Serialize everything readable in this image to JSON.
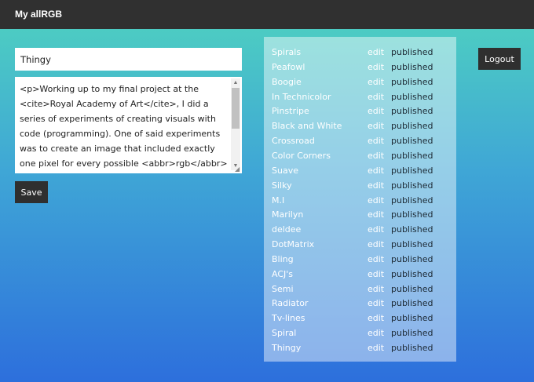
{
  "header": {
    "brand": "My allRGB"
  },
  "editor": {
    "title_value": "Thingy",
    "body_value": "<p>Working up to my final project at the <cite>Royal Academy of Art</cite>, I did a series of experiments of creating visuals with code (programming). One of said experiments was to create an image that included exactly one pixel for every possible <abbr>rgb</abbr> value. This one",
    "save_label": "Save"
  },
  "list": {
    "items": [
      {
        "name": "Spirals",
        "edit": "edit",
        "status": "published"
      },
      {
        "name": "Peafowl",
        "edit": "edit",
        "status": "published"
      },
      {
        "name": "Boogie",
        "edit": "edit",
        "status": "published"
      },
      {
        "name": "In Technicolor",
        "edit": "edit",
        "status": "published"
      },
      {
        "name": "Pinstripe",
        "edit": "edit",
        "status": "published"
      },
      {
        "name": "Black and White",
        "edit": "edit",
        "status": "published"
      },
      {
        "name": "Crossroad",
        "edit": "edit",
        "status": "published"
      },
      {
        "name": "Color Corners",
        "edit": "edit",
        "status": "published"
      },
      {
        "name": "Suave",
        "edit": "edit",
        "status": "published"
      },
      {
        "name": "Silky",
        "edit": "edit",
        "status": "published"
      },
      {
        "name": "M.I",
        "edit": "edit",
        "status": "published"
      },
      {
        "name": "Marilyn",
        "edit": "edit",
        "status": "published"
      },
      {
        "name": "deldee",
        "edit": "edit",
        "status": "published"
      },
      {
        "name": "DotMatrix",
        "edit": "edit",
        "status": "published"
      },
      {
        "name": "Bling",
        "edit": "edit",
        "status": "published"
      },
      {
        "name": "ACJ's",
        "edit": "edit",
        "status": "published"
      },
      {
        "name": "Semi",
        "edit": "edit",
        "status": "published"
      },
      {
        "name": "Radiator",
        "edit": "edit",
        "status": "published"
      },
      {
        "name": "Tv-lines",
        "edit": "edit",
        "status": "published"
      },
      {
        "name": "Spiral",
        "edit": "edit",
        "status": "published"
      },
      {
        "name": "Thingy",
        "edit": "edit",
        "status": "published"
      }
    ]
  },
  "account": {
    "logout_label": "Logout"
  }
}
